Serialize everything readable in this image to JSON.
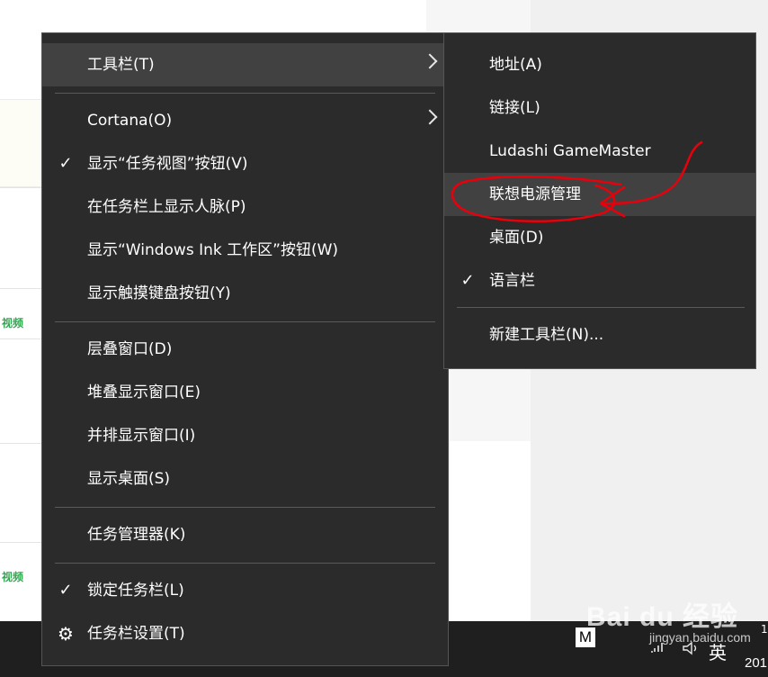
{
  "background": {
    "green_labels": [
      "视频",
      "视频"
    ]
  },
  "main_menu": {
    "items": [
      {
        "label": "工具栏(T)",
        "checked": false,
        "submenu": true,
        "icon": ""
      },
      {
        "label": "Cortana(O)",
        "checked": false,
        "submenu": true,
        "icon": ""
      },
      {
        "label": "显示“任务视图”按钮(V)",
        "checked": true,
        "submenu": false,
        "icon": ""
      },
      {
        "label": "在任务栏上显示人脉(P)",
        "checked": false,
        "submenu": false,
        "icon": ""
      },
      {
        "label": "显示“Windows Ink 工作区”按钮(W)",
        "checked": false,
        "submenu": false,
        "icon": ""
      },
      {
        "label": "显示触摸键盘按钮(Y)",
        "checked": false,
        "submenu": false,
        "icon": ""
      },
      {
        "label": "层叠窗口(D)",
        "checked": false,
        "submenu": false,
        "icon": ""
      },
      {
        "label": "堆叠显示窗口(E)",
        "checked": false,
        "submenu": false,
        "icon": ""
      },
      {
        "label": "并排显示窗口(I)",
        "checked": false,
        "submenu": false,
        "icon": ""
      },
      {
        "label": "显示桌面(S)",
        "checked": false,
        "submenu": false,
        "icon": ""
      },
      {
        "label": "任务管理器(K)",
        "checked": false,
        "submenu": false,
        "icon": ""
      },
      {
        "label": "锁定任务栏(L)",
        "checked": true,
        "submenu": false,
        "icon": ""
      },
      {
        "label": "任务栏设置(T)",
        "checked": false,
        "submenu": false,
        "icon": "gear-icon"
      }
    ]
  },
  "toolbar_submenu": {
    "items": [
      {
        "label": "地址(A)",
        "checked": false
      },
      {
        "label": "链接(L)",
        "checked": false
      },
      {
        "label": "Ludashi GameMaster",
        "checked": false
      },
      {
        "label": "联想电源管理",
        "checked": false
      },
      {
        "label": "桌面(D)",
        "checked": false
      },
      {
        "label": "语言栏",
        "checked": true
      },
      {
        "label": "新建工具栏(N)...",
        "checked": false
      }
    ]
  },
  "taskbar": {
    "tray_app_letter": "M",
    "language": "英",
    "year_fragment": "201",
    "clock_fragment": "1"
  },
  "watermark": {
    "main": "Bai du 经验",
    "sub": "jingyan.baidu.com"
  },
  "glyphs": {
    "check": "✓",
    "gear": "⚙"
  },
  "colors": {
    "menu_bg": "#2b2b2b",
    "menu_hover": "#414141",
    "annotation": "#e8000b"
  }
}
